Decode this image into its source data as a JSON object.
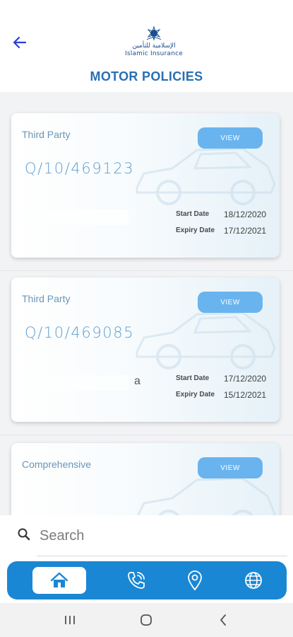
{
  "header": {
    "title": "MOTOR POLICIES",
    "logo_text_ar": "الإسلامية للتأمين",
    "logo_text_en": "Islamic Insurance"
  },
  "policies": [
    {
      "type": "Third Party",
      "number": "Q/10/469123",
      "holder_tail": "",
      "view_label": "VIEW",
      "start_label": "Start Date",
      "start_date": "18/12/2020",
      "expiry_label": "Expiry Date",
      "expiry_date": "17/12/2021"
    },
    {
      "type": "Third Party",
      "number": "Q/10/469085",
      "holder_tail": "a",
      "view_label": "VIEW",
      "start_label": "Start Date",
      "start_date": "17/12/2020",
      "expiry_label": "Expiry Date",
      "expiry_date": "15/12/2021"
    },
    {
      "type": "Comprehensive",
      "view_label": "VIEW"
    }
  ],
  "search": {
    "placeholder": "Search"
  },
  "nav": {
    "active": "home",
    "items": [
      "home-icon",
      "phone-icon",
      "location-icon",
      "globe-icon"
    ]
  },
  "colors": {
    "brand": "#2a6fb5",
    "nav": "#1a87d4",
    "view_button": "#69b4ee"
  }
}
